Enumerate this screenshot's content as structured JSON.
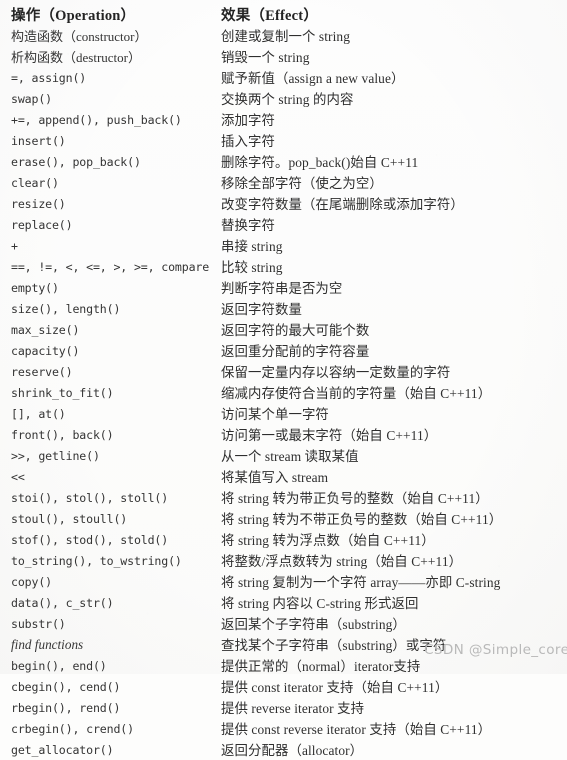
{
  "document": {
    "type": "scanned-reference-table",
    "subject": "C++ std::string operations",
    "watermark": "CSDN @Simple_core"
  },
  "table": {
    "headers": {
      "operation": "操作（Operation）",
      "effect": "效果（Effect）"
    },
    "rows": [
      {
        "op": "构造函数（constructor）",
        "op_style": "serif",
        "eff": "创建或复制一个 string"
      },
      {
        "op": "析构函数（destructor）",
        "op_style": "serif",
        "eff": "销毁一个 string"
      },
      {
        "op": "=, assign()",
        "op_style": "mono",
        "eff": "赋予新值（assign a new value）"
      },
      {
        "op": "swap()",
        "op_style": "mono",
        "eff": "交换两个 string 的内容"
      },
      {
        "op": "+=, append(), push_back()",
        "op_style": "mono",
        "eff": "添加字符"
      },
      {
        "op": "insert()",
        "op_style": "mono",
        "eff": "插入字符"
      },
      {
        "op": "erase(), pop_back()",
        "op_style": "mono",
        "eff": "删除字符。pop_back()始自 C++11"
      },
      {
        "op": "clear()",
        "op_style": "mono",
        "eff": "移除全部字符（使之为空）"
      },
      {
        "op": "resize()",
        "op_style": "mono",
        "eff": "改变字符数量（在尾端删除或添加字符）"
      },
      {
        "op": "replace()",
        "op_style": "mono",
        "eff": "替换字符"
      },
      {
        "op": "+",
        "op_style": "mono",
        "eff": "串接 string"
      },
      {
        "op": "==, !=, <, <=, >, >=, compare()",
        "op_style": "mono",
        "eff": "比较 string"
      },
      {
        "op": "empty()",
        "op_style": "mono",
        "eff": "判断字符串是否为空"
      },
      {
        "op": "size(), length()",
        "op_style": "mono",
        "eff": "返回字符数量"
      },
      {
        "op": "max_size()",
        "op_style": "mono",
        "eff": "返回字符的最大可能个数"
      },
      {
        "op": "capacity()",
        "op_style": "mono",
        "eff": "返回重分配前的字符容量"
      },
      {
        "op": "reserve()",
        "op_style": "mono",
        "eff": "保留一定量内存以容纳一定数量的字符"
      },
      {
        "op": "shrink_to_fit()",
        "op_style": "mono",
        "eff": "缩减内存使符合当前的字符量（始自 C++11）"
      },
      {
        "op": "[], at()",
        "op_style": "mono",
        "eff": "访问某个单一字符"
      },
      {
        "op": "front(), back()",
        "op_style": "mono",
        "eff": "访问第一或最末字符（始自 C++11）"
      },
      {
        "op": ">>, getline()",
        "op_style": "mono",
        "eff": "从一个 stream 读取某值"
      },
      {
        "op": "<<",
        "op_style": "mono",
        "eff": "将某值写入 stream"
      },
      {
        "op": "stoi(), stol(), stoll()",
        "op_style": "mono",
        "eff": "将 string 转为带正负号的整数（始自 C++11）"
      },
      {
        "op": "stoul(), stoull()",
        "op_style": "mono",
        "eff": "将 string 转为不带正负号的整数（始自 C++11）"
      },
      {
        "op": "stof(), stod(), stold()",
        "op_style": "mono",
        "eff": "将 string 转为浮点数（始自 C++11）"
      },
      {
        "op": "to_string(), to_wstring()",
        "op_style": "mono",
        "eff": "将整数/浮点数转为 string（始自 C++11）"
      },
      {
        "op": "copy()",
        "op_style": "mono",
        "eff": "将 string 复制为一个字符 array——亦即 C-string"
      },
      {
        "op": "data(), c_str()",
        "op_style": "mono",
        "eff": "将 string 内容以 C-string 形式返回"
      },
      {
        "op": "substr()",
        "op_style": "mono",
        "eff": "返回某个子字符串（substring）"
      },
      {
        "op": "find functions",
        "op_style": "italic",
        "eff": "查找某个子字符串（substring）或字符"
      },
      {
        "op": "begin(), end()",
        "op_style": "mono",
        "eff": "提供正常的（normal）iterator支持"
      },
      {
        "op": "cbegin(), cend()",
        "op_style": "mono",
        "eff": "提供 const iterator 支持（始自 C++11）"
      },
      {
        "op": "rbegin(), rend()",
        "op_style": "mono",
        "eff": "提供 reverse iterator 支持"
      },
      {
        "op": "crbegin(), crend()",
        "op_style": "mono",
        "eff": "提供 const reverse iterator 支持（始自 C++11）"
      },
      {
        "op": "get_allocator()",
        "op_style": "mono",
        "eff": "返回分配器（allocator）"
      }
    ]
  },
  "colors": {
    "page_background": "#fdfdfc",
    "rule": "#4c4c4c",
    "text": "#2e2e2e",
    "watermark": "#b9b9b9"
  }
}
